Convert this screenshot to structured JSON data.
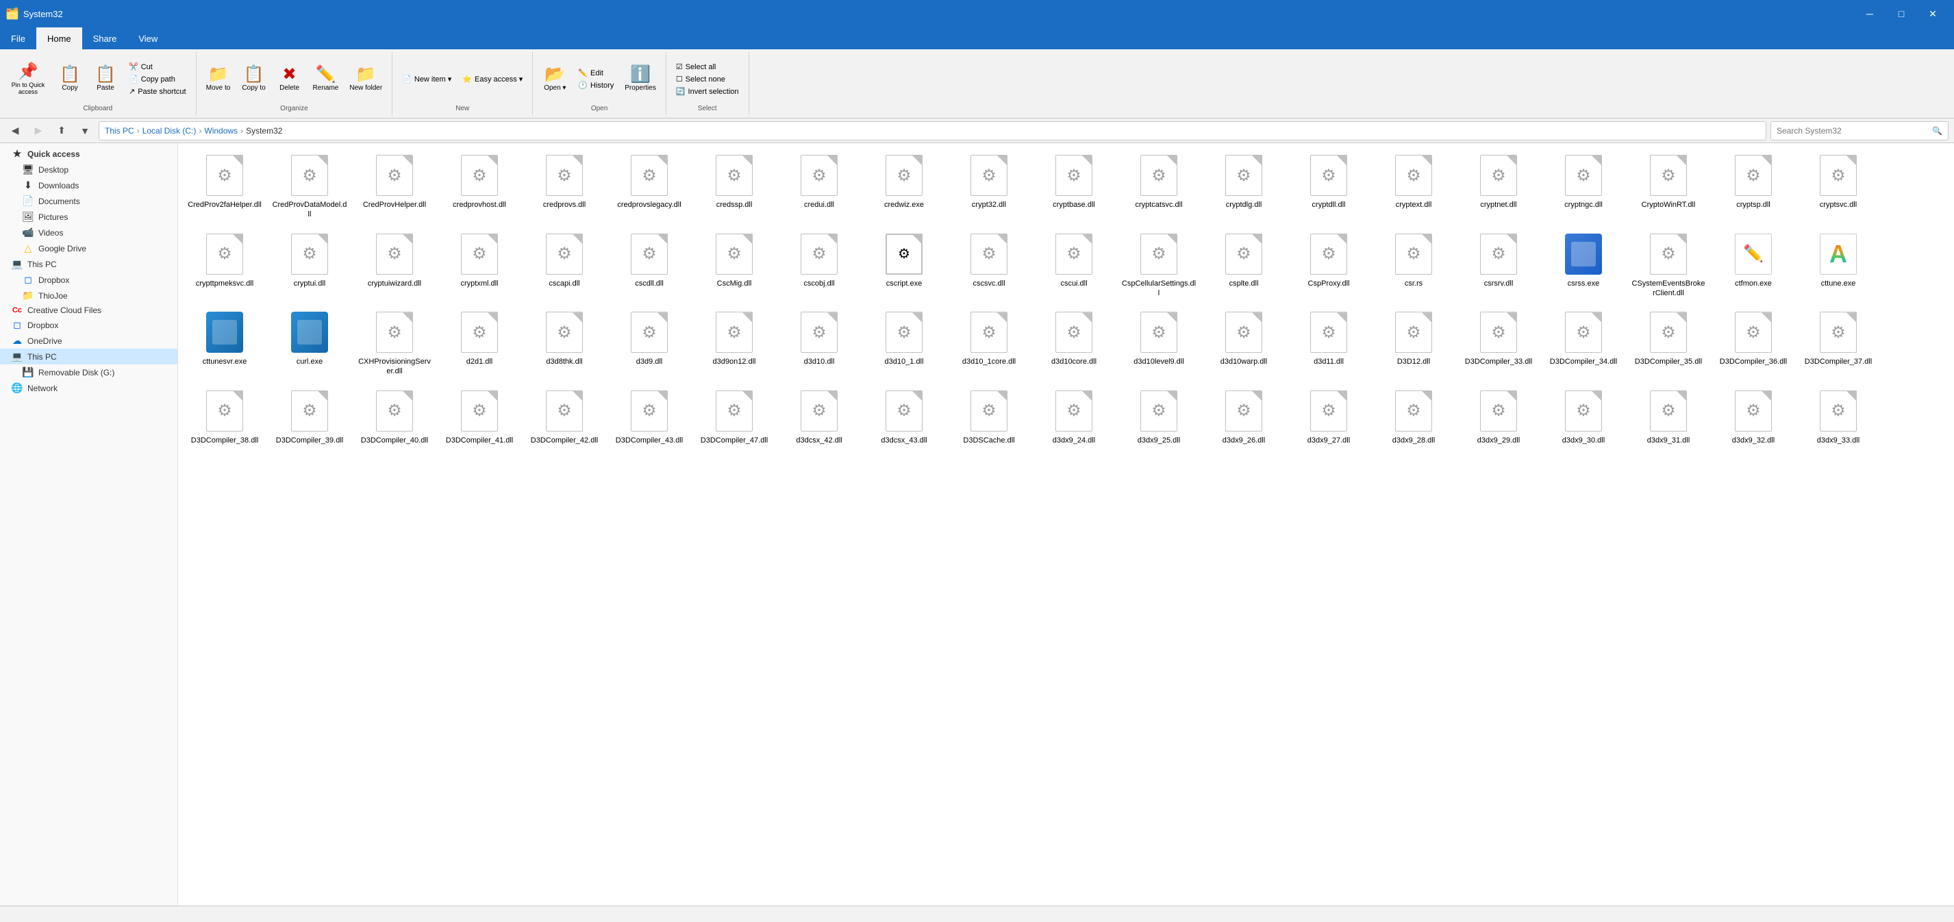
{
  "titleBar": {
    "icon": "🗂️",
    "title": "System32",
    "minimizeLabel": "─",
    "maximizeLabel": "□",
    "closeLabel": "✕"
  },
  "ribbon": {
    "tabs": [
      {
        "label": "File",
        "active": false
      },
      {
        "label": "Home",
        "active": true
      },
      {
        "label": "Share",
        "active": false
      },
      {
        "label": "View",
        "active": false
      }
    ],
    "groups": {
      "clipboard": {
        "label": "Clipboard",
        "pinToQuick": "Pin to Quick access",
        "copy": "Copy",
        "paste": "Paste",
        "cut": "Cut",
        "copyPath": "Copy path",
        "pasteShortcut": "Paste shortcut"
      },
      "organize": {
        "label": "Organize",
        "moveTo": "Move to",
        "copyTo": "Copy to",
        "delete": "Delete",
        "rename": "Rename",
        "newFolder": "New folder"
      },
      "new": {
        "label": "New",
        "newItem": "New item ▾",
        "easyAccess": "Easy access ▾"
      },
      "open": {
        "label": "Open",
        "open": "Open ▾",
        "edit": "Edit",
        "history": "History",
        "properties": "Properties"
      },
      "select": {
        "label": "Select",
        "selectAll": "Select all",
        "selectNone": "Select none",
        "invertSelection": "Invert selection"
      }
    }
  },
  "addressBar": {
    "breadcrumb": [
      "This PC",
      "Local Disk (C:)",
      "Windows",
      "System32"
    ],
    "searchPlaceholder": "Search System32"
  },
  "sidebar": {
    "quickAccess": "Quick access",
    "items": [
      {
        "id": "desktop",
        "label": "Desktop",
        "icon": "🖥️",
        "indent": 1
      },
      {
        "id": "downloads",
        "label": "Downloads",
        "icon": "⬇️",
        "indent": 1
      },
      {
        "id": "documents",
        "label": "Documents",
        "icon": "📄",
        "indent": 1
      },
      {
        "id": "pictures",
        "label": "Pictures",
        "icon": "🖼️",
        "indent": 1
      },
      {
        "id": "videos",
        "label": "Videos",
        "icon": "📹",
        "indent": 1
      },
      {
        "id": "google-drive",
        "label": "Google Drive",
        "icon": "△",
        "indent": 1
      },
      {
        "id": "this-pc",
        "label": "This PC",
        "icon": "💻",
        "indent": 0
      },
      {
        "id": "dropbox",
        "label": "Dropbox",
        "icon": "📦",
        "indent": 1
      },
      {
        "id": "thiojoe",
        "label": "ThioJoe",
        "icon": "📁",
        "indent": 1
      },
      {
        "id": "creative-cloud",
        "label": "Creative Cloud Files",
        "icon": "Cc",
        "indent": 0
      },
      {
        "id": "dropbox2",
        "label": "Dropbox",
        "icon": "📦",
        "indent": 0
      },
      {
        "id": "onedrive",
        "label": "OneDrive",
        "icon": "☁️",
        "indent": 0
      },
      {
        "id": "this-pc-2",
        "label": "This PC",
        "icon": "💻",
        "indent": 0,
        "active": true
      },
      {
        "id": "removable",
        "label": "Removable Disk (G:)",
        "icon": "💾",
        "indent": 1
      },
      {
        "id": "network",
        "label": "Network",
        "icon": "🌐",
        "indent": 0
      }
    ]
  },
  "files": [
    {
      "name": "CredProv2faHelper.dll",
      "type": "dll"
    },
    {
      "name": "CredProvDataModel.dll",
      "type": "dll"
    },
    {
      "name": "CredProvHelper.dll",
      "type": "dll"
    },
    {
      "name": "credprovhost.dll",
      "type": "dll"
    },
    {
      "name": "credprovs.dll",
      "type": "dll"
    },
    {
      "name": "credprovslegacy.dll",
      "type": "dll"
    },
    {
      "name": "credssp.dll",
      "type": "dll"
    },
    {
      "name": "credui.dll",
      "type": "dll"
    },
    {
      "name": "credwiz.exe",
      "type": "dll"
    },
    {
      "name": "crypt32.dll",
      "type": "dll"
    },
    {
      "name": "cryptbase.dll",
      "type": "dll"
    },
    {
      "name": "cryptcatsvc.dll",
      "type": "dll"
    },
    {
      "name": "cryptdlg.dll",
      "type": "dll"
    },
    {
      "name": "cryptdll.dll",
      "type": "dll"
    },
    {
      "name": "cryptext.dll",
      "type": "dll"
    },
    {
      "name": "cryptnet.dll",
      "type": "dll"
    },
    {
      "name": "cryptngc.dll",
      "type": "dll"
    },
    {
      "name": "CryptoWinRT.dll",
      "type": "dll"
    },
    {
      "name": "cryptsp.dll",
      "type": "dll"
    },
    {
      "name": "cryptsvc.dll",
      "type": "dll"
    },
    {
      "name": "crypttpmeksvc.dll",
      "type": "dll"
    },
    {
      "name": "cryptui.dll",
      "type": "dll"
    },
    {
      "name": "cryptuiwizard.dll",
      "type": "dll"
    },
    {
      "name": "cryptxml.dll",
      "type": "dll"
    },
    {
      "name": "cscapi.dll",
      "type": "dll"
    },
    {
      "name": "cscdll.dll",
      "type": "dll"
    },
    {
      "name": "CscMig.dll",
      "type": "dll"
    },
    {
      "name": "cscobj.dll",
      "type": "dll"
    },
    {
      "name": "cscript.exe",
      "type": "special-cscript"
    },
    {
      "name": "cscsvc.dll",
      "type": "dll"
    },
    {
      "name": "cscui.dll",
      "type": "dll"
    },
    {
      "name": "CspCellularSettings.dll",
      "type": "dll"
    },
    {
      "name": "csplte.dll",
      "type": "dll"
    },
    {
      "name": "CspProxy.dll",
      "type": "dll"
    },
    {
      "name": "csr.rs",
      "type": "dll"
    },
    {
      "name": "csrsrv.dll",
      "type": "dll"
    },
    {
      "name": "csrss.exe",
      "type": "exe-blue"
    },
    {
      "name": "CSystemEventsBrokerClient.dll",
      "type": "dll"
    },
    {
      "name": "ctfmon.exe",
      "type": "ctfmon"
    },
    {
      "name": "cttune.exe",
      "type": "font-a"
    },
    {
      "name": "cttunesvr.exe",
      "type": "exe-blue2"
    },
    {
      "name": "curl.exe",
      "type": "exe-blue3"
    },
    {
      "name": "CXHProvisioningServer.dll",
      "type": "dll"
    },
    {
      "name": "d2d1.dll",
      "type": "dll"
    },
    {
      "name": "d3d8thk.dll",
      "type": "dll"
    },
    {
      "name": "d3d9.dll",
      "type": "dll"
    },
    {
      "name": "d3d9on12.dll",
      "type": "dll"
    },
    {
      "name": "d3d10.dll",
      "type": "dll"
    },
    {
      "name": "d3d10_1.dll",
      "type": "dll"
    },
    {
      "name": "d3d10_1core.dll",
      "type": "dll"
    },
    {
      "name": "d3d10core.dll",
      "type": "dll"
    },
    {
      "name": "d3d10level9.dll",
      "type": "dll"
    },
    {
      "name": "d3d10warp.dll",
      "type": "dll"
    },
    {
      "name": "d3d11.dll",
      "type": "dll"
    },
    {
      "name": "D3D12.dll",
      "type": "dll"
    },
    {
      "name": "D3DCompiler_33.dll",
      "type": "dll"
    },
    {
      "name": "D3DCompiler_34.dll",
      "type": "dll"
    },
    {
      "name": "D3DCompiler_35.dll",
      "type": "dll"
    },
    {
      "name": "D3DCompiler_36.dll",
      "type": "dll"
    },
    {
      "name": "D3DCompiler_37.dll",
      "type": "dll"
    },
    {
      "name": "D3DCompiler_38.dll",
      "type": "dll"
    },
    {
      "name": "D3DCompiler_39.dll",
      "type": "dll"
    },
    {
      "name": "D3DCompiler_40.dll",
      "type": "dll"
    },
    {
      "name": "D3DCompiler_41.dll",
      "type": "dll"
    },
    {
      "name": "D3DCompiler_42.dll",
      "type": "dll"
    },
    {
      "name": "D3DCompiler_43.dll",
      "type": "dll"
    },
    {
      "name": "D3DCompiler_47.dll",
      "type": "dll"
    },
    {
      "name": "d3dcsx_42.dll",
      "type": "dll"
    },
    {
      "name": "d3dcsx_43.dll",
      "type": "dll"
    },
    {
      "name": "D3DSCache.dll",
      "type": "dll"
    },
    {
      "name": "d3dx9_24.dll",
      "type": "dll"
    },
    {
      "name": "d3dx9_25.dll",
      "type": "dll"
    },
    {
      "name": "d3dx9_26.dll",
      "type": "dll"
    },
    {
      "name": "d3dx9_27.dll",
      "type": "dll"
    },
    {
      "name": "d3dx9_28.dll",
      "type": "dll"
    },
    {
      "name": "d3dx9_29.dll",
      "type": "dll"
    },
    {
      "name": "d3dx9_30.dll",
      "type": "dll"
    },
    {
      "name": "d3dx9_31.dll",
      "type": "dll"
    },
    {
      "name": "d3dx9_32.dll",
      "type": "dll"
    },
    {
      "name": "d3dx9_33.dll",
      "type": "dll"
    }
  ],
  "statusBar": {
    "text": ""
  }
}
